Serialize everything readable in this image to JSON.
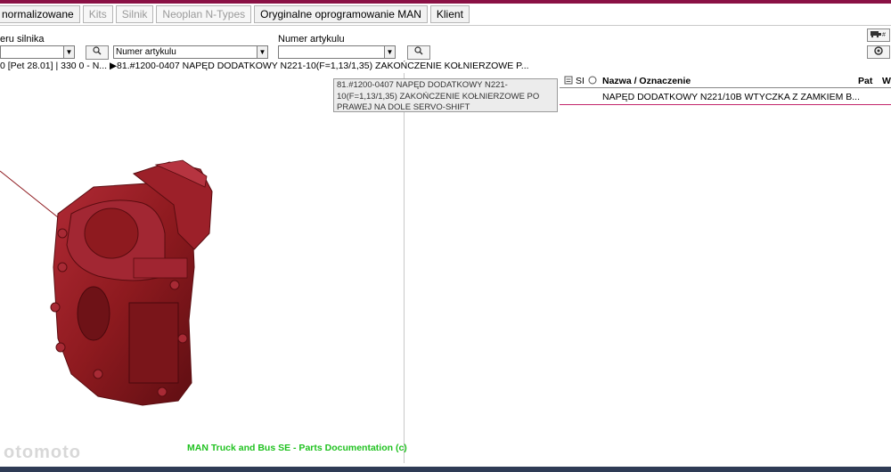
{
  "tabs": [
    {
      "label": "normalizowane",
      "enabled": true
    },
    {
      "label": "Kits",
      "enabled": false
    },
    {
      "label": "Silnik",
      "enabled": false
    },
    {
      "label": "Neoplan N-Types",
      "enabled": false
    },
    {
      "label": "Oryginalne oprogramowanie MAN",
      "enabled": true
    },
    {
      "label": "Klient",
      "enabled": true
    }
  ],
  "search": {
    "label_engine": "eru silnika",
    "label_article": "Numer artykulu",
    "article_combo_value": "Numer artykulu",
    "search_icon": "magnifier-icon"
  },
  "right_buttons": {
    "top_icon": "truck-grid-icon",
    "second_icon": "wheel-icon"
  },
  "path": {
    "segments": "0   [Pet 28.01]   | 330 0 - N...",
    "selected": "▶81.#1200-0407  NAPĘD DODATKOWY  N221-10(F=1,13/1,35) ZAKOŃCZENIE KOŁNIERZOWE P..."
  },
  "tooltip": {
    "text": "81.#1200-0407  NAPĘD DODATKOWY  N221-10(F=1,13/1,35) ZAKOŃCZENIE KOŁNIERZOWE PO PRAWEJ NA DOLE SERVO-SHIFT"
  },
  "table": {
    "columns": [
      "SI",
      "Nazwa / Oznaczenie",
      "Pat",
      "W"
    ],
    "rows": [
      {
        "name": "NAPĘD DODATKOWY  N221/10B WTYCZKA Z ZAMKIEM B..."
      }
    ]
  },
  "credit": "MAN Truck and Bus SE - Parts Documentation (c)",
  "watermark": "otomoto",
  "colors": {
    "brand": "#8a1145",
    "part": "#8e1a1f",
    "credit": "#21c221",
    "row_border": "#c2246b"
  }
}
